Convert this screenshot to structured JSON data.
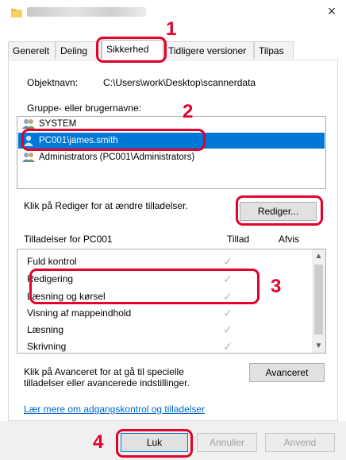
{
  "window": {
    "close_glyph": "×"
  },
  "tabs": [
    {
      "label": "Generelt"
    },
    {
      "label": "Deling"
    },
    {
      "label": "Sikkerhed"
    },
    {
      "label": "Tidligere versioner"
    },
    {
      "label": "Tilpas"
    }
  ],
  "security": {
    "object_name_label": "Objektnavn:",
    "object_name_value": "C:\\Users\\work\\Desktop\\scannerdata",
    "groups_label": "Gruppe- eller brugernavne:",
    "groups": [
      {
        "label": "SYSTEM",
        "icon": "users-icon"
      },
      {
        "label": "PC001\\james.smith",
        "icon": "user-icon",
        "selected": true
      },
      {
        "label": "Administrators (PC001\\Administrators)",
        "icon": "users-icon"
      }
    ],
    "edit_hint": "Klik på Rediger for at ændre tilladelser.",
    "edit_button": "Rediger...",
    "permissions_for": "Tilladelser for PC001",
    "allow_header": "Tillad",
    "deny_header": "Afvis",
    "permissions": [
      {
        "label": "Fuld kontrol",
        "allow": "✓"
      },
      {
        "label": "Redigering",
        "allow": "✓"
      },
      {
        "label": "Læsning og kørsel",
        "allow": "✓"
      },
      {
        "label": "Visning af mappeindhold",
        "allow": "✓"
      },
      {
        "label": "Læsning",
        "allow": "✓"
      },
      {
        "label": "Skrivning",
        "allow": "✓"
      }
    ],
    "advanced_hint_1": "Klik på Avanceret for at gå til specielle",
    "advanced_hint_2": "tilladelser eller avancerede indstillinger.",
    "advanced_button": "Avanceret",
    "learn_more_link": "Lær mere om adgangskontrol og tilladelser"
  },
  "footer": {
    "close_button": "Luk",
    "cancel_button": "Annuller",
    "apply_button": "Anvend"
  },
  "callouts": [
    "1",
    "2",
    "3",
    "4"
  ],
  "colors": {
    "accent": "#0078d7",
    "callout": "#e4002b"
  }
}
